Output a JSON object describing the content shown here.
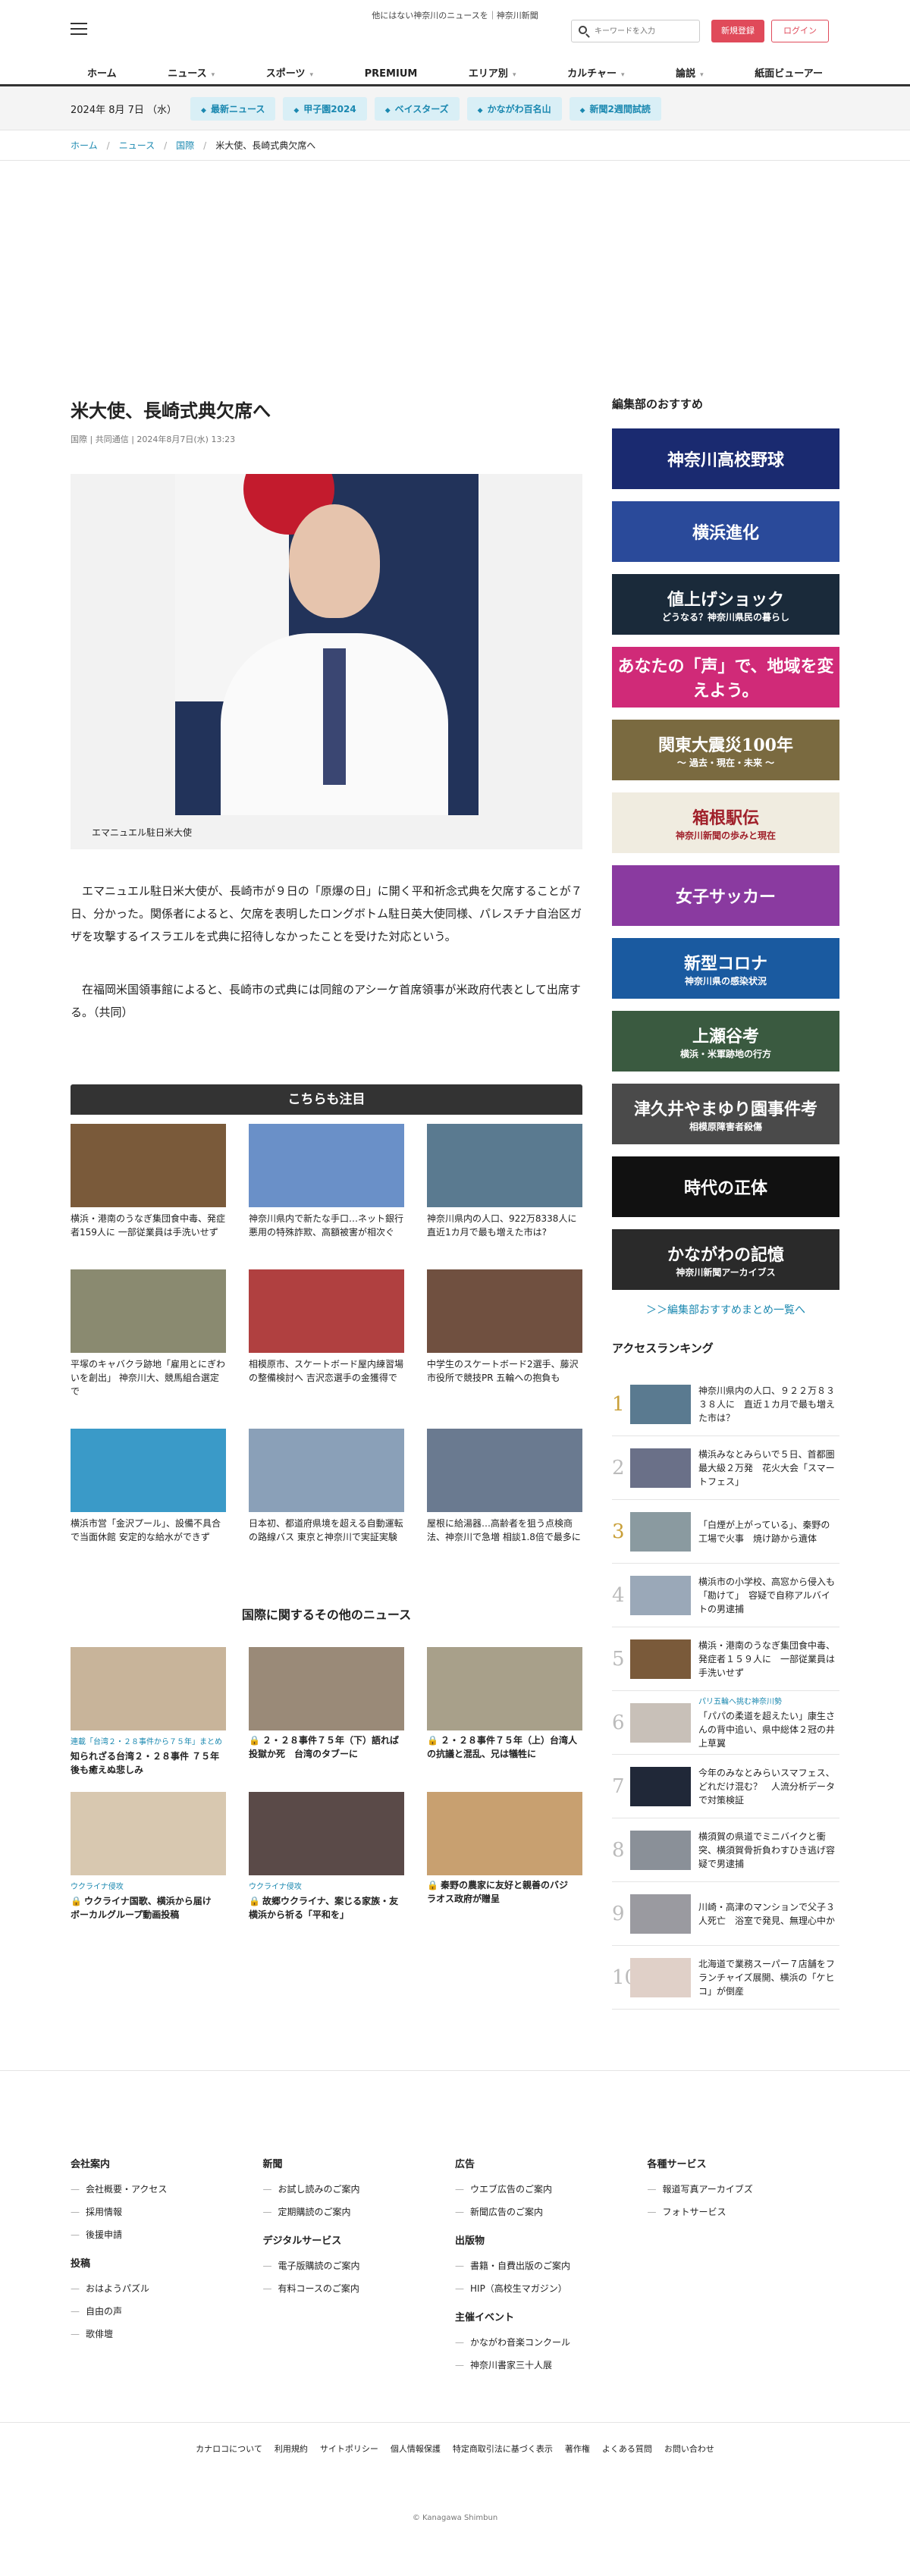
{
  "header": {
    "tagline": "他にはない神奈川のニュースを｜神奈川新聞",
    "search_placeholder": "キーワードを入力",
    "register": "新規登録",
    "login": "ログイン"
  },
  "nav": [
    "ホーム",
    "ニュース",
    "スポーツ",
    "PREMIUM",
    "エリア別",
    "カルチャー",
    "論説",
    "紙面ビューアー"
  ],
  "sub": {
    "date": "2024年 8月 7日 （水）",
    "pills": [
      "最新ニュース",
      "甲子園2024",
      "ベイスターズ",
      "かながわ百名山",
      "新聞2週間試読"
    ]
  },
  "crumbs": [
    "ホーム",
    "ニュース",
    "国際",
    "米大使、長崎式典欠席へ"
  ],
  "article": {
    "title": "米大使、長崎式典欠席へ",
    "meta": "国際 | 共同通信 | 2024年8月7日(水) 13:23",
    "caption": "エマニュエル駐日米大使",
    "p1": "エマニュエル駐日米大使が、長崎市が９日の「原爆の日」に開く平和祈念式典を欠席することが７日、分かった。関係者によると、欠席を表明したロングボトム駐日英大使同様、パレスチナ自治区ガザを攻撃するイスラエルを式典に招待しなかったことを受けた対応という。",
    "p2": "在福岡米国領事館によると、長崎市の式典には同館のアシーケ首席領事が米政府代表として出席する。（共同）"
  },
  "attention": {
    "heading": "こちらも注目",
    "items": [
      {
        "title": "横浜・港南のうなぎ集団食中毒、発症者159人に 一部従業員は手洗いせず",
        "color": "#7a5a3a"
      },
      {
        "title": "神奈川県内で新たな手口…ネット銀行悪用の特殊詐欺、高額被害が相次ぐ",
        "color": "#6a90c8"
      },
      {
        "title": "神奈川県内の人口、922万8338人に 直近1カ月で最も増えた市は?",
        "color": "#5a7a90"
      },
      {
        "title": "平塚のキャバクラ跡地「雇用とにぎわいを創出」 神奈川大、競馬組合選定で",
        "color": "#8a8a70"
      },
      {
        "title": "相模原市、スケートボード屋内練習場の整備検討へ 吉沢恋選手の金獲得で",
        "color": "#b04040"
      },
      {
        "title": "中学生のスケートボード2選手、藤沢市役所で競技PR 五輪への抱負も",
        "color": "#705040"
      },
      {
        "title": "横浜市営「金沢プール」、設備不具合で当面休館 安定的な給水ができず",
        "color": "#3a9ac8"
      },
      {
        "title": "日本初、都道府県境を超える自動運転の路線バス 東京と神奈川で実証実験",
        "color": "#8aa0b8"
      },
      {
        "title": "屋根に給湯器…高齢者を狙う点検商法、神奈川で急増 相談1.8倍で最多に",
        "color": "#6a7a90"
      }
    ]
  },
  "others": {
    "heading": "国際に関するその他のニュース",
    "items": [
      {
        "tag": "連載「台湾２・２８事件から７５年」まとめ",
        "title": "知られざる台湾２・２８事件 ７５年後も癒えぬ悲しみ",
        "lock": false,
        "color": "#c8b49a"
      },
      {
        "tag": "",
        "title": "２・２８事件７５年（下）語れば投獄か死　台湾のタブーに",
        "lock": true,
        "color": "#9a8a78"
      },
      {
        "tag": "",
        "title": "２・２８事件７５年（上）台湾人の抗議と混乱、兄は犠牲に",
        "lock": true,
        "color": "#a8a08a"
      },
      {
        "tag": "ウクライナ侵攻",
        "title": "ウクライナ国歌、横浜から届け　ボーカルグループ動画投稿",
        "lock": true,
        "color": "#d8c8b0"
      },
      {
        "tag": "ウクライナ侵攻",
        "title": "故郷ウクライナ、案じる家族・友　横浜から祈る「平和を」",
        "lock": true,
        "color": "#5a4a48"
      },
      {
        "tag": "",
        "title": "秦野の農家に友好と親善のバジ　ラオス政府が贈呈",
        "lock": true,
        "color": "#c8a070"
      }
    ]
  },
  "side": {
    "heading": "編集部のおすすめ",
    "banners": [
      {
        "text": "神奈川高校野球",
        "sub": "",
        "color": "#1a2a70"
      },
      {
        "text": "横浜進化",
        "sub": "",
        "color": "#2a4a9a"
      },
      {
        "text": "値上げショック",
        "sub": "どうなる？神奈川県民の暮らし",
        "color": "#1a2a3a"
      },
      {
        "text": "あなたの「声」で、地域を変えよう。",
        "sub": "",
        "color": "#d02a78"
      },
      {
        "text": "関東大震災100年",
        "sub": "〜 過去・現在・未来 〜",
        "color": "#7a6a40"
      },
      {
        "text": "箱根駅伝",
        "sub": "神奈川新聞の歩みと現在",
        "color": "#f0ece0"
      },
      {
        "text": "女子サッカー",
        "sub": "",
        "color": "#8a3aa0"
      },
      {
        "text": "新型コロナ",
        "sub": "神奈川県の感染状況",
        "color": "#1a5aa0"
      },
      {
        "text": "上瀬谷考",
        "sub": "横浜・米軍跡地の行方",
        "color": "#3a5a40"
      },
      {
        "text": "津久井やまゆり園事件考",
        "sub": "相模原障害者殺傷",
        "color": "#4a4a4a"
      },
      {
        "text": "時代の正体",
        "sub": "",
        "color": "#111111"
      },
      {
        "text": "かながわの記憶",
        "sub": "神奈川新聞アーカイブス",
        "color": "#2a2a2a"
      }
    ],
    "more": "＞＞編集部おすすめまとめ一覧へ",
    "ranking_heading": "アクセスランキング",
    "ranking": [
      {
        "n": "1",
        "tag": "",
        "title": "神奈川県内の人口、９２２万８３３８人に　直近１カ月で最も増えた市は？",
        "color": "#5a7a90"
      },
      {
        "n": "2",
        "tag": "",
        "title": "横浜みなとみらいで５日、首都圏最大級２万発　花火大会「スマートフェス」",
        "color": "#6a7088"
      },
      {
        "n": "3",
        "tag": "",
        "title": "「白煙が上がっている」、秦野の工場で火事　焼け跡から遺体",
        "color": "#8a9aa0"
      },
      {
        "n": "4",
        "tag": "",
        "title": "横浜市の小学校、高窓から侵入も「勘けて」　容疑で自称アルバイトの男逮捕",
        "color": "#9aa8b8"
      },
      {
        "n": "5",
        "tag": "",
        "title": "横浜・港南のうなぎ集団食中毒、発症者１５９人に　一部従業員は手洗いせず",
        "color": "#7a5a3a"
      },
      {
        "n": "6",
        "tag": "パリ五輪へ挑む神奈川勢",
        "title": "「パパの柔道を超えたい」康生さんの背中追い、県中総体２冠の井上草翼",
        "color": "#c8c0b8"
      },
      {
        "n": "7",
        "tag": "",
        "title": "今年のみなとみらいスマフェス、どれだけ混む？　人流分析データで対策検証",
        "color": "#202838"
      },
      {
        "n": "8",
        "tag": "",
        "title": "横須賀の県道でミニバイクと衝突、横須賀骨折負わすひき逃げ容疑で男逮捕",
        "color": "#8a9098"
      },
      {
        "n": "9",
        "tag": "",
        "title": "川崎・高津のマンションで父子３人死亡　浴室で発見、無理心中か",
        "color": "#9a9aa0"
      },
      {
        "n": "10",
        "tag": "",
        "title": "北海道で業務スーパー７店舗をフランチャイズ展開、横浜の「ケヒコ」が倒産",
        "color": "#e0d0c8"
      }
    ]
  },
  "footer": {
    "cols": [
      [
        {
          "h": "会社案内",
          "items": [
            "会社概要・アクセス",
            "採用情報",
            "後援申請"
          ]
        },
        {
          "h": "投稿",
          "items": [
            "おはようパズル",
            "自由の声",
            "歌俳壇"
          ]
        }
      ],
      [
        {
          "h": "新聞",
          "items": [
            "お試し読みのご案内",
            "定期購読のご案内"
          ]
        },
        {
          "h": "デジタルサービス",
          "items": [
            "電子版購読のご案内",
            "有料コースのご案内"
          ]
        }
      ],
      [
        {
          "h": "広告",
          "items": [
            "ウエブ広告のご案内",
            "新聞広告のご案内"
          ]
        },
        {
          "h": "出版物",
          "items": [
            "書籍・自費出版のご案内",
            "HIP（高校生マガジン）"
          ]
        },
        {
          "h": "主催イベント",
          "items": [
            "かながわ音楽コンクール",
            "神奈川書家三十人展"
          ]
        }
      ],
      [
        {
          "h": "各種サービス",
          "items": [
            "報道写真アーカイブズ",
            "フォトサービス"
          ]
        }
      ]
    ],
    "links": [
      "カナロコについて",
      "利用規約",
      "サイトポリシー",
      "個人情報保護",
      "特定商取引法に基づく表示",
      "著作権",
      "よくある質問",
      "お問い合わせ"
    ],
    "copyright": "© Kanagawa Shimbun"
  }
}
